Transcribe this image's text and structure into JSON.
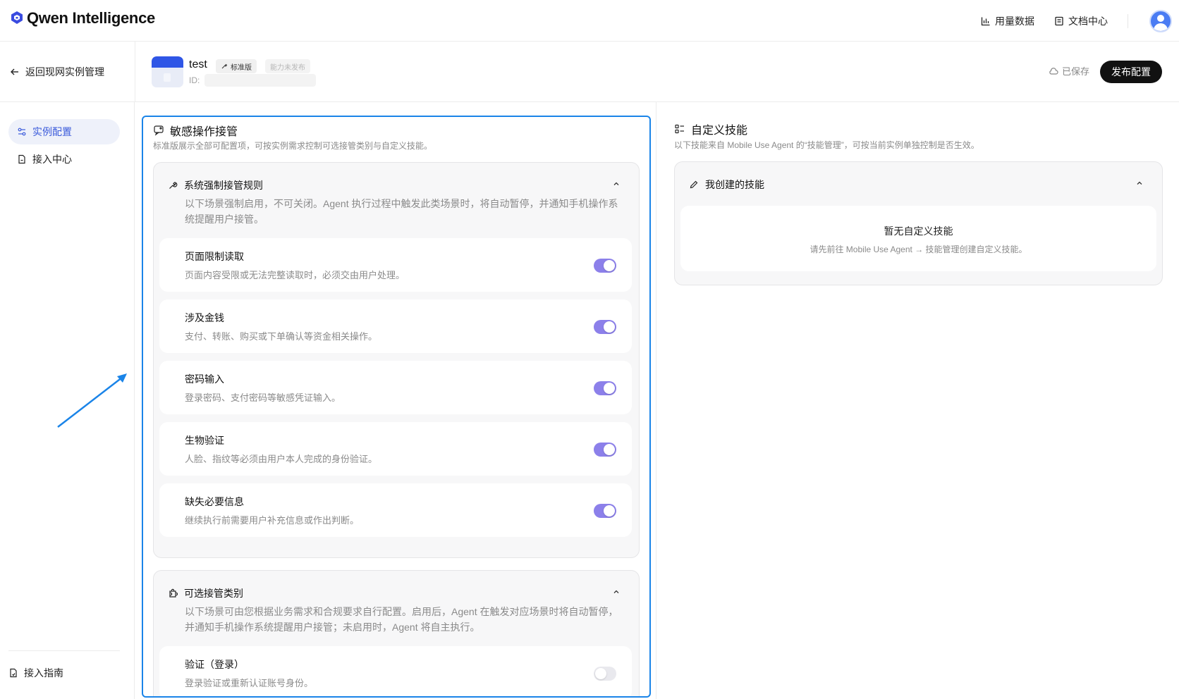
{
  "topbar": {
    "brand": "Qwen Intelligence",
    "links": [
      {
        "label": "用量数据",
        "icon": "bar-chart-icon"
      },
      {
        "label": "文档中心",
        "icon": "document-icon"
      }
    ]
  },
  "subheader": {
    "back_label": "返回现网实例管理",
    "app_name": "test",
    "tag_standard": "标准版",
    "tag_unpublished": "能力未发布",
    "id_label": "ID:",
    "saved_label": "已保存",
    "publish_label": "发布配置"
  },
  "nav": {
    "items": [
      {
        "label": "实例配置",
        "active": true
      },
      {
        "label": "接入中心",
        "active": false
      }
    ],
    "guide_label": "接入指南"
  },
  "sensitive": {
    "title": "敏感操作接管",
    "desc": "标准版展示全部可配置项，可按实例需求控制可选接管类别与自定义技能。",
    "forced": {
      "title": "系统强制接管规则",
      "desc": "以下场景强制启用，不可关闭。Agent 执行过程中触发此类场景时，将自动暂停，并通知手机操作系统提醒用户接管。",
      "items": [
        {
          "title": "页面限制读取",
          "desc": "页面内容受限或无法完整读取时，必须交由用户处理。",
          "enabled": true
        },
        {
          "title": "涉及金钱",
          "desc": "支付、转账、购买或下单确认等资金相关操作。",
          "enabled": true
        },
        {
          "title": "密码输入",
          "desc": "登录密码、支付密码等敏感凭证输入。",
          "enabled": true
        },
        {
          "title": "生物验证",
          "desc": "人脸、指纹等必须由用户本人完成的身份验证。",
          "enabled": true
        },
        {
          "title": "缺失必要信息",
          "desc": "继续执行前需要用户补充信息或作出判断。",
          "enabled": true
        }
      ]
    },
    "optional": {
      "title": "可选接管类别",
      "desc_line1": "以下场景可由您根据业务需求和合规要求自行配置。启用后，Agent 在触发对应场景时将自动暂停，",
      "desc_line2": "并通知手机操作系统提醒用户接管；未启用时，Agent 将自主执行。",
      "items": [
        {
          "title": "验证（登录）",
          "desc": "登录验证或重新认证账号身份。",
          "enabled": false
        }
      ]
    }
  },
  "skills": {
    "title": "自定义技能",
    "desc": "以下技能来自 Mobile Use Agent 的“技能管理”，可按当前实例单独控制是否生效。",
    "mine_title": "我创建的技能",
    "empty_title": "暂无自定义技能",
    "empty_desc": "请先前往 Mobile Use Agent → 技能管理创建自定义技能。"
  },
  "colors": {
    "accent": "#3b5bdb",
    "toggle_on": "#8c80ea",
    "annotation": "#1a84e8"
  }
}
